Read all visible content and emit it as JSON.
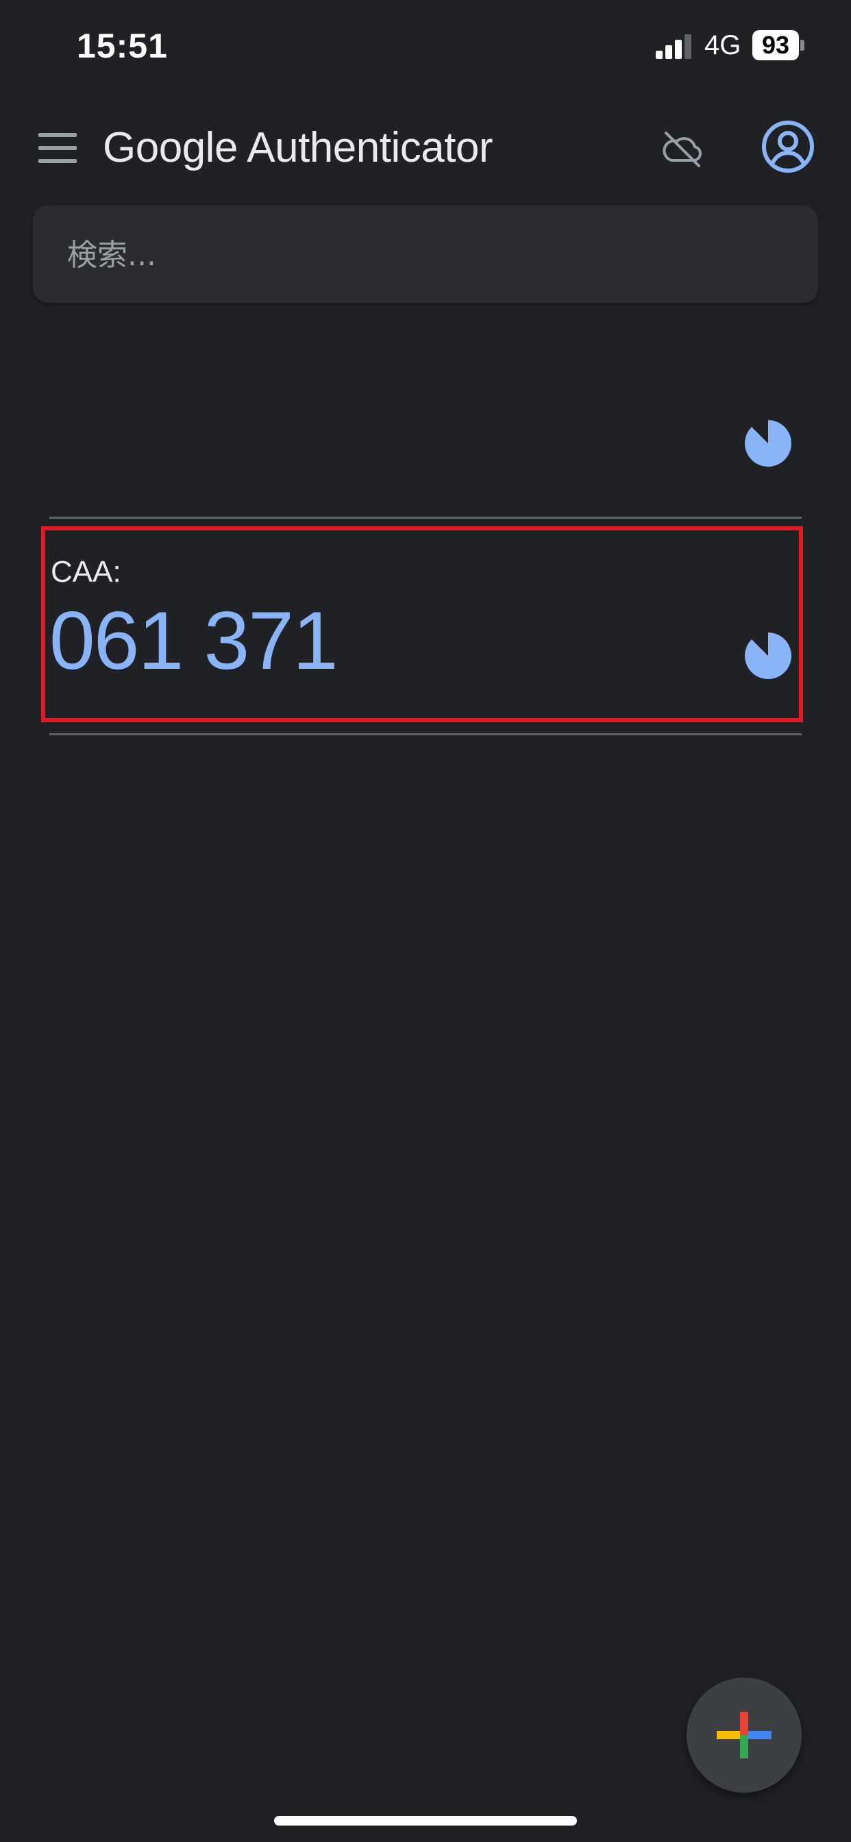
{
  "status_bar": {
    "time": "15:51",
    "network": "4G",
    "battery": "93",
    "icons": [
      "signal-icon",
      "battery-icon"
    ]
  },
  "app_bar": {
    "title": "Google Authenticator",
    "icons": [
      "menu-icon",
      "cloud-off-icon",
      "account-circle-icon"
    ]
  },
  "search": {
    "placeholder": "検索...",
    "value": ""
  },
  "accounts": [
    {
      "name": "",
      "code": "",
      "timer_icon": "countdown-timer-icon"
    },
    {
      "name": "CAA:",
      "code": "061 371",
      "timer_icon": "countdown-timer-icon"
    }
  ],
  "colors": {
    "background": "#202124",
    "search_background": "#2b2c30",
    "code": "#8ab4f8",
    "timer": "#8ab4f8",
    "highlight": "#e01b24",
    "fab_background": "#3c4043"
  },
  "fab": {
    "icon": "add-icon"
  }
}
